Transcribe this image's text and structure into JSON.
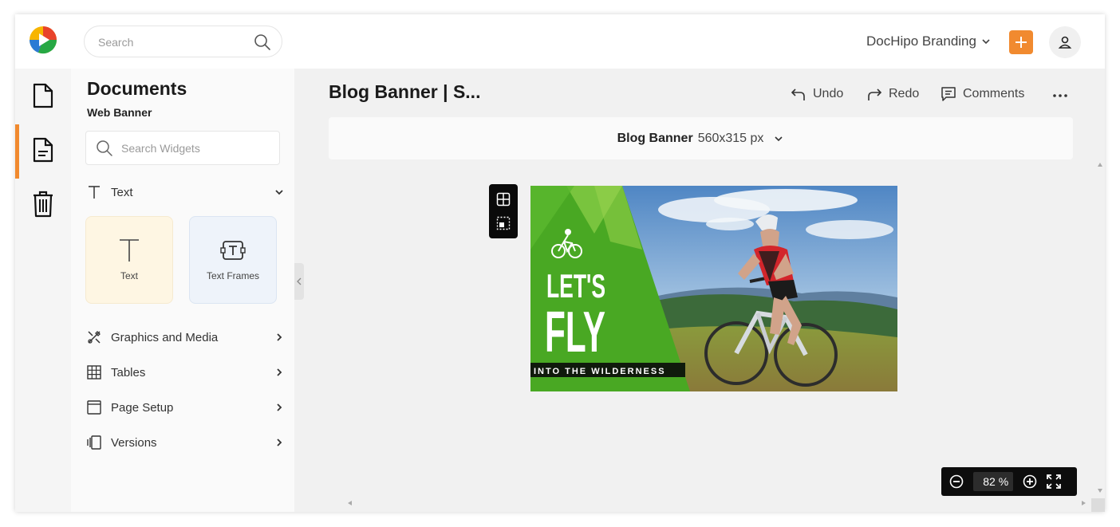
{
  "header": {
    "search_placeholder": "Search",
    "brand_label": "DocHipo Branding",
    "accent_color": "#f18a2f"
  },
  "rail": {
    "items": [
      {
        "icon": "document-icon"
      },
      {
        "icon": "document-lines-icon",
        "active": true
      },
      {
        "icon": "trash-icon"
      }
    ]
  },
  "panel": {
    "title": "Documents",
    "subtitle": "Web Banner",
    "search_placeholder": "Search Widgets",
    "text_section": {
      "label": "Text",
      "expanded": true
    },
    "cards": [
      {
        "label": "Text",
        "icon": "text-icon"
      },
      {
        "label": "Text Frames",
        "icon": "text-frame-icon"
      }
    ],
    "sections": [
      {
        "label": "Graphics and Media",
        "icon": "graphics-icon"
      },
      {
        "label": "Tables",
        "icon": "table-icon"
      },
      {
        "label": "Page Setup",
        "icon": "page-setup-icon"
      },
      {
        "label": "Versions",
        "icon": "versions-icon"
      }
    ]
  },
  "editor": {
    "doc_title": "Blog Banner | S...",
    "undo_label": "Undo",
    "redo_label": "Redo",
    "comments_label": "Comments",
    "size_name": "Blog Banner",
    "size_value": "560x315 px",
    "zoom_value": "82",
    "zoom_unit": "%"
  },
  "banner": {
    "headline_line1": "LET'S",
    "headline_line2": "FLY",
    "tagline": "INTO THE WILDERNESS",
    "green_color": "#4caf25"
  }
}
